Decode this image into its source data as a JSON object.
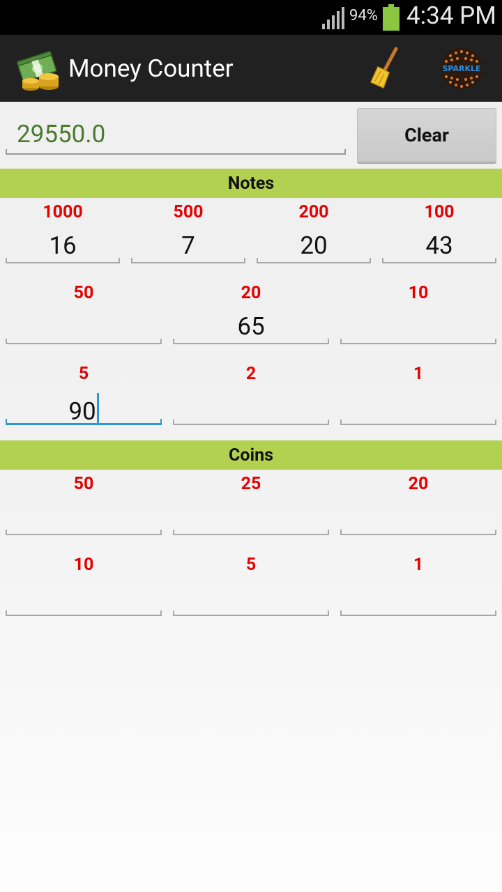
{
  "status_bar": {
    "battery": "94%",
    "time": "4:34 PM"
  },
  "app_bar": {
    "title": "Money Counter",
    "icons": [
      "money-icon",
      "broom-icon",
      "sparkle-logo-icon"
    ],
    "sparkle_text": "SPARKLE"
  },
  "total": {
    "value": "29550.0",
    "clear_label": "Clear"
  },
  "notes": {
    "header": "Notes",
    "rows": [
      [
        {
          "denom": "1000",
          "count": "16"
        },
        {
          "denom": "500",
          "count": "7"
        },
        {
          "denom": "200",
          "count": "20"
        },
        {
          "denom": "100",
          "count": "43"
        }
      ],
      [
        {
          "denom": "50",
          "count": ""
        },
        {
          "denom": "20",
          "count": "65"
        },
        {
          "denom": "10",
          "count": ""
        }
      ],
      [
        {
          "denom": "5",
          "count": "90"
        },
        {
          "denom": "2",
          "count": ""
        },
        {
          "denom": "1",
          "count": ""
        }
      ]
    ]
  },
  "coins": {
    "header": "Coins",
    "rows": [
      [
        {
          "denom": "50",
          "count": ""
        },
        {
          "denom": "25",
          "count": ""
        },
        {
          "denom": "20",
          "count": ""
        }
      ],
      [
        {
          "denom": "10",
          "count": ""
        },
        {
          "denom": "5",
          "count": ""
        },
        {
          "denom": "1",
          "count": ""
        }
      ]
    ]
  },
  "colors": {
    "accent": "#b2d150",
    "denomination": "#e60000",
    "total_text": "#4a7a2e",
    "focus": "#2a97d4"
  }
}
